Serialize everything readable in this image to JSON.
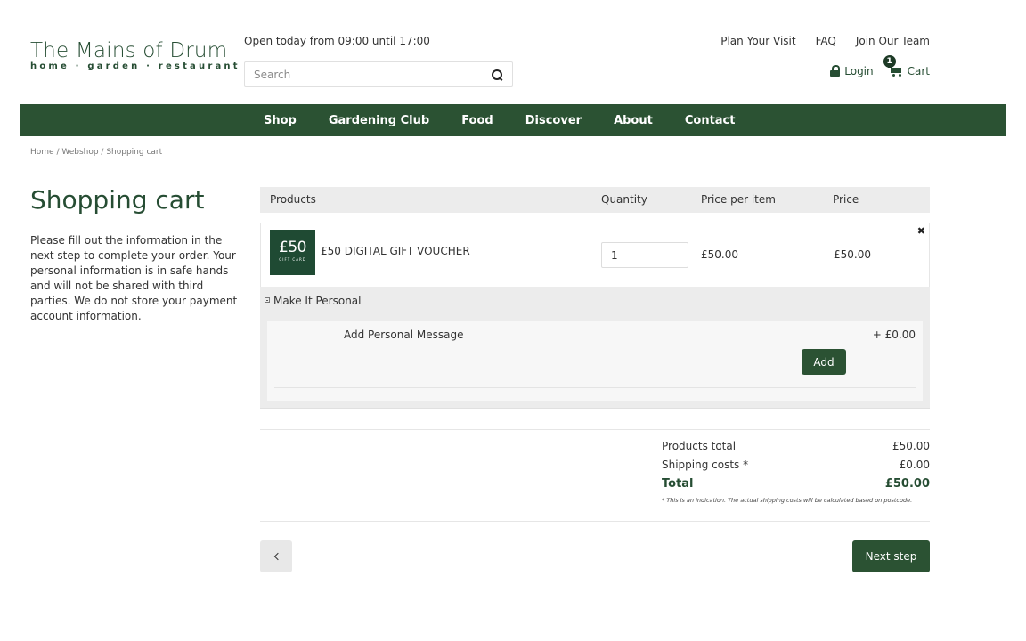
{
  "brand": {
    "name": "The Mains of Drum",
    "tagline": "home · garden · restaurant",
    "color": "#264d33"
  },
  "header": {
    "hours": "Open today from 09:00 until 17:00",
    "search_placeholder": "Search",
    "links": [
      "Plan Your Visit",
      "FAQ",
      "Join Our Team"
    ],
    "login_label": "Login",
    "cart_label": "Cart",
    "cart_count": "1"
  },
  "nav": {
    "items": [
      "Shop",
      "Gardening Club",
      "Food",
      "Discover",
      "About",
      "Contact"
    ],
    "background": "#2b5233"
  },
  "breadcrumb": "Home / Webshop / Shopping cart",
  "page": {
    "title": "Shopping cart",
    "intro": "Please fill out the information in the next step to complete your order. Your personal information is in safe hands and will not be shared with third parties. We do not store your payment account information."
  },
  "cart": {
    "columns": [
      "Products",
      "Quantity",
      "Price per item",
      "Price"
    ],
    "items": [
      {
        "thumb_amount": "£50",
        "thumb_caption": "GIFT CARD",
        "name": "£50 DIGITAL GIFT VOUCHER",
        "quantity": "1",
        "price_per_item": "£50.00",
        "price": "£50.00",
        "remove_icon": "close-icon"
      }
    ],
    "option_group": {
      "title": "Make It Personal",
      "option_label": "Add Personal Message",
      "option_price": "+ £0.00",
      "add_label": "Add"
    }
  },
  "totals": {
    "products_total_label": "Products total",
    "products_total": "£50.00",
    "shipping_label": "Shipping costs *",
    "shipping": "£0.00",
    "total_label": "Total",
    "total": "£50.00",
    "note": "* This is an indication. The actual shipping costs will be calculated based on postcode."
  },
  "actions": {
    "back_icon": "chevron-left-icon",
    "next_label": "Next step"
  }
}
